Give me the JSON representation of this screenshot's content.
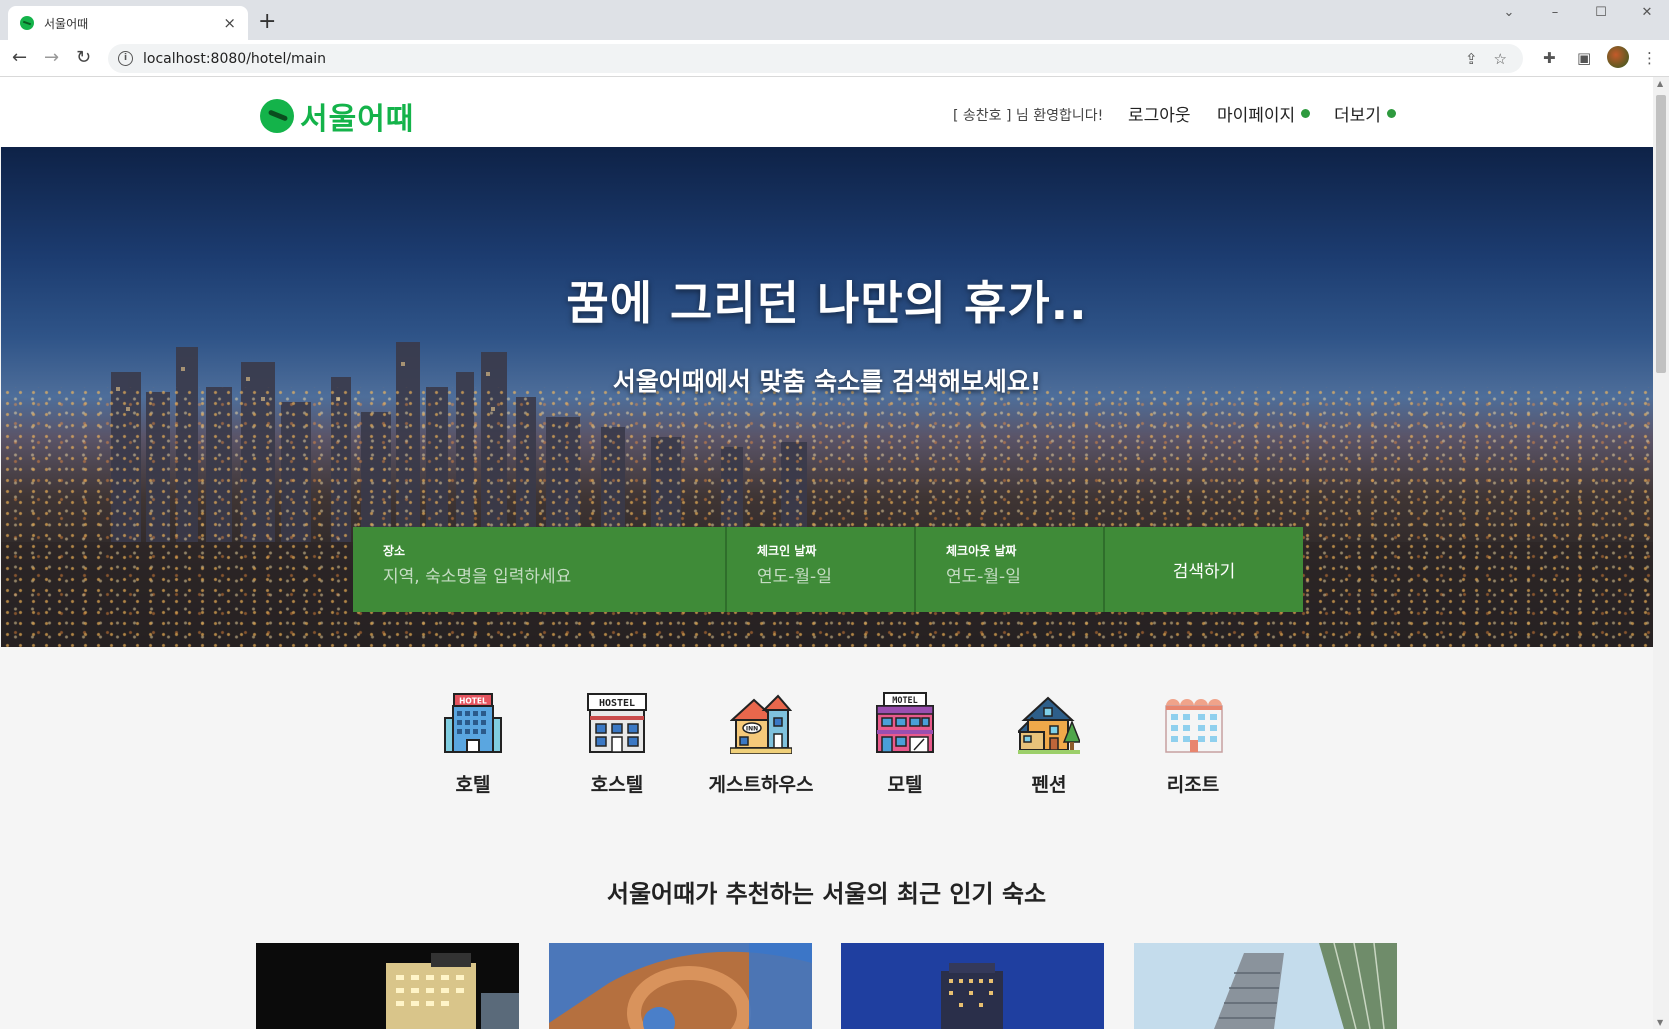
{
  "browser": {
    "tab_title": "서울어때",
    "tab_close": "×",
    "new_tab": "+",
    "url": "localhost:8080/hotel/main",
    "window_controls": [
      "⌄",
      "–",
      "☐",
      "✕"
    ]
  },
  "header": {
    "logo_text": "서울어때",
    "welcome": "[ 송찬호 ] 님 환영합니다!",
    "logout": "로그아웃",
    "mypage": "마이페이지",
    "more": "더보기"
  },
  "hero": {
    "title": "꿈에 그리던 나만의 휴가..",
    "subtitle": "서울어때에서 맞춤 숙소를 검색해보세요!"
  },
  "search": {
    "place_label": "장소",
    "place_placeholder": "지역, 숙소명을 입력하세요",
    "checkin_label": "체크인 날짜",
    "checkin_placeholder": "연도-월-일",
    "checkout_label": "체크아웃 날짜",
    "checkout_placeholder": "연도-월-일",
    "button": "검색하기"
  },
  "categories": [
    {
      "label": "호텔",
      "icon": "hotel-icon"
    },
    {
      "label": "호스텔",
      "icon": "hostel-icon"
    },
    {
      "label": "게스트하우스",
      "icon": "inn-icon"
    },
    {
      "label": "모텔",
      "icon": "motel-icon"
    },
    {
      "label": "펜션",
      "icon": "pension-icon"
    },
    {
      "label": "리조트",
      "icon": "resort-icon"
    }
  ],
  "recommend_title": "서울어때가 추천하는 서울의 최근 인기 숙소",
  "colors": {
    "brand": "#14b34a",
    "search_green": "#3f8b38",
    "menu_dot": "#2e9a3e"
  }
}
